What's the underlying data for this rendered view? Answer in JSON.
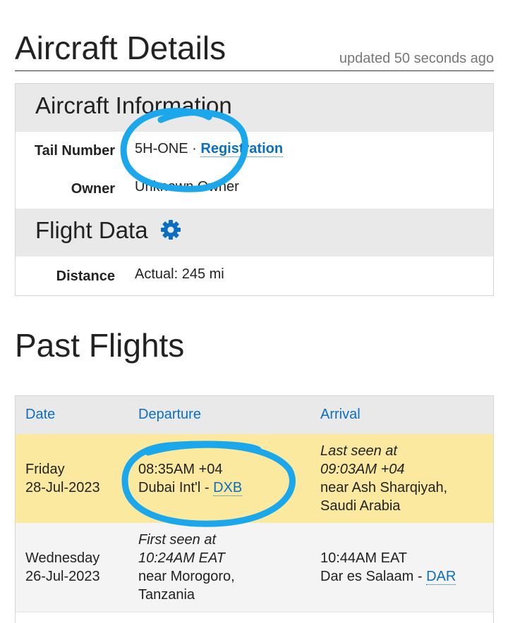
{
  "header": {
    "title": "Aircraft Details",
    "updated": "updated 50 seconds ago"
  },
  "aircraft_info": {
    "heading": "Aircraft Information",
    "tail_number_label": "Tail Number",
    "tail_number": "5H-ONE",
    "separator": "·",
    "registration_link": "Registration",
    "owner_label": "Owner",
    "owner": "Unknown Owner"
  },
  "flight_data": {
    "heading": "Flight Data",
    "gear_icon": "gear-icon",
    "distance_label": "Distance",
    "distance": "Actual: 245 mi"
  },
  "past_flights": {
    "heading": "Past Flights",
    "columns": [
      "Date",
      "Departure",
      "Arrival"
    ],
    "rows": [
      {
        "day": "Friday",
        "date": "28-Jul-2023",
        "dep_time": "08:35AM +04",
        "dep_airport": "Dubai Int'l -",
        "dep_code": "DXB",
        "arr_prefix": "Last seen at",
        "arr_time": "09:03AM +04",
        "arr_loc1": "near Ash Sharqiyah,",
        "arr_loc2": "Saudi Arabia"
      },
      {
        "day": "Wednesday",
        "date": "26-Jul-2023",
        "dep_prefix": "First seen at",
        "dep_time": "10:24AM EAT",
        "dep_loc1": "near Morogoro,",
        "dep_loc2": "Tanzania",
        "arr_time": "10:44AM EAT",
        "arr_airport": "Dar es Salaam -",
        "arr_code": "DAR"
      }
    ]
  },
  "colors": {
    "link": "#0a6fc2",
    "highlight_row": "#fbe9a0",
    "marker": "#1aa7ec"
  }
}
